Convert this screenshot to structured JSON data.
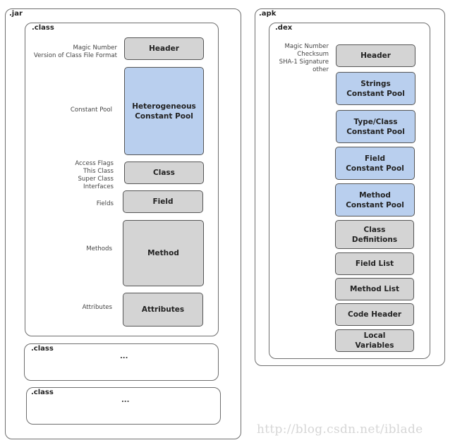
{
  "jar": {
    "title": ".jar",
    "class_main": {
      "title": ".class",
      "rows": [
        {
          "label": "Magic Number\nVersion of Class File Format",
          "block": "Header",
          "color": "gray"
        },
        {
          "label": "Constant Pool",
          "block": "Heterogeneous\nConstant Pool",
          "color": "blue"
        },
        {
          "label": "Access Flags\nThis Class\nSuper Class\nInterfaces",
          "block": "Class",
          "color": "gray"
        },
        {
          "label": "Fields",
          "block": "Field",
          "color": "gray"
        },
        {
          "label": "Methods",
          "block": "Method",
          "color": "gray"
        },
        {
          "label": "Attributes",
          "block": "Attributes",
          "color": "gray"
        }
      ]
    },
    "class_more": [
      {
        "title": ".class",
        "ellipsis": "..."
      },
      {
        "title": ".class",
        "ellipsis": "..."
      }
    ]
  },
  "apk": {
    "title": ".apk",
    "dex": {
      "title": ".dex",
      "header_label": "Magic Number\nChecksum\nSHA-1 Signature\nother",
      "blocks": [
        {
          "text": "Header",
          "color": "gray"
        },
        {
          "text": "Strings\nConstant Pool",
          "color": "blue"
        },
        {
          "text": "Type/Class\nConstant Pool",
          "color": "blue"
        },
        {
          "text": "Field\nConstant Pool",
          "color": "blue"
        },
        {
          "text": "Method\nConstant Pool",
          "color": "blue"
        },
        {
          "text": "Class\nDefinitions",
          "color": "gray"
        },
        {
          "text": "Field List",
          "color": "gray"
        },
        {
          "text": "Method List",
          "color": "gray"
        },
        {
          "text": "Code Header",
          "color": "gray"
        },
        {
          "text": "Local\nVariables",
          "color": "gray"
        }
      ]
    }
  },
  "colors": {
    "constant_pool": "#b9cfee",
    "section": "#d4d4d4",
    "border": "#555555"
  },
  "watermark": "http://blog.csdn.net/iblade"
}
